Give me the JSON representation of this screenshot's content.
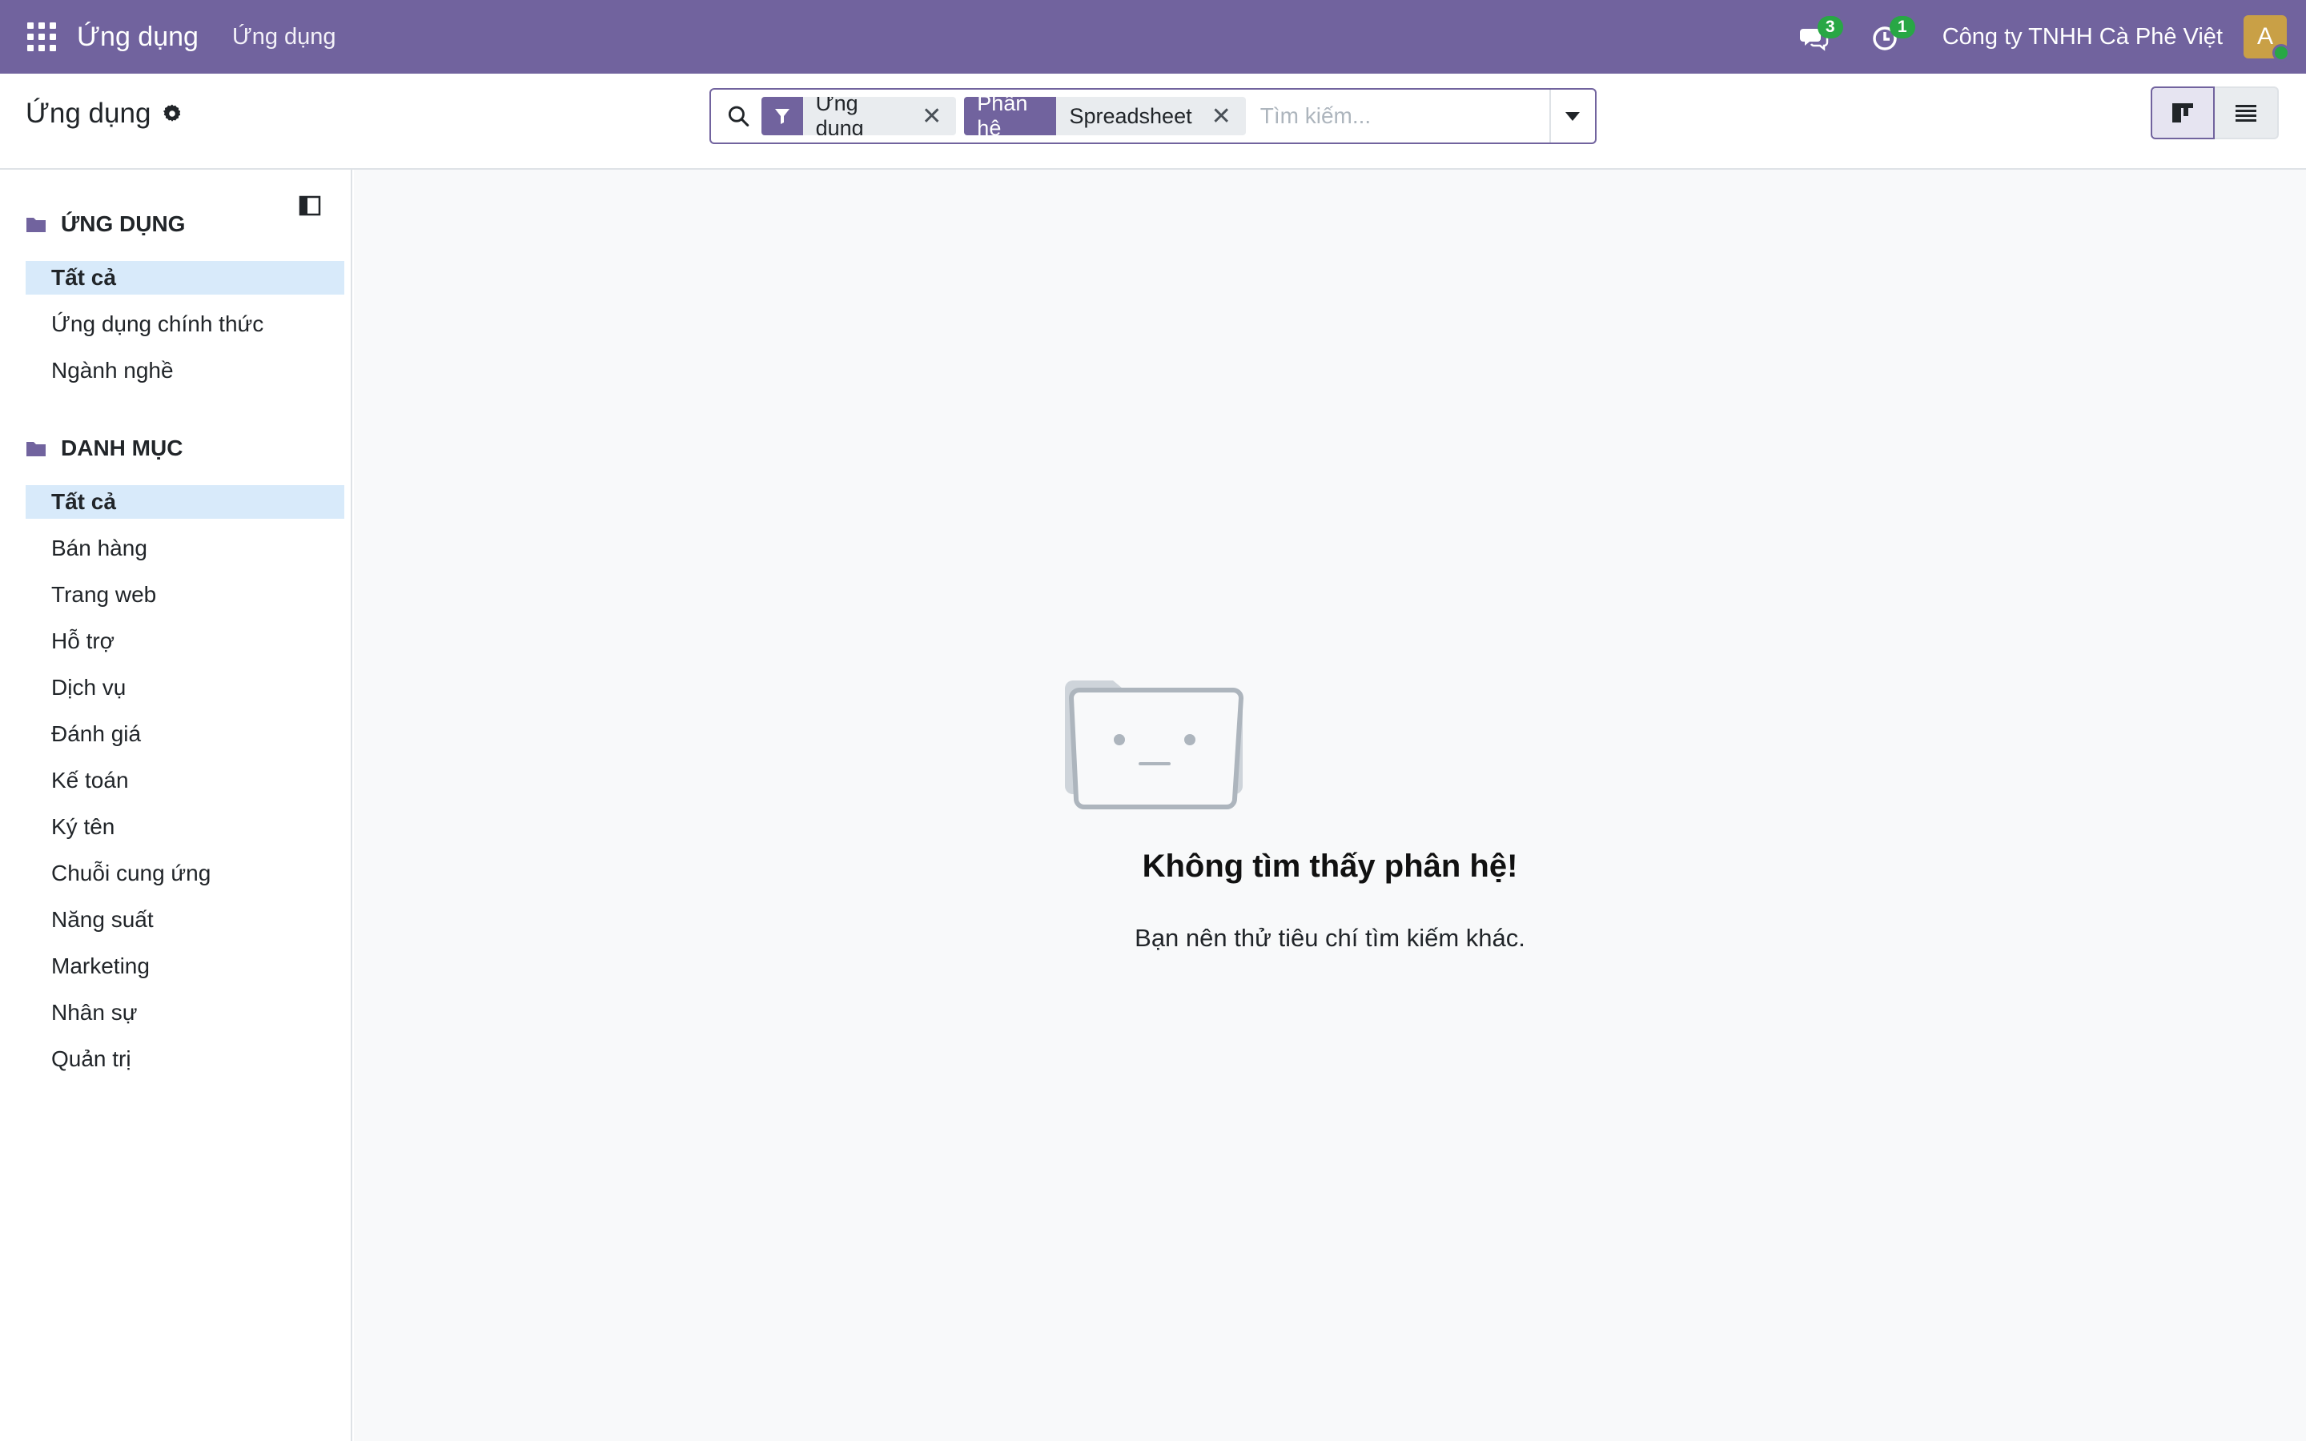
{
  "navbar": {
    "brand": "Ứng dụng",
    "menu_item": "Ứng dụng",
    "messages_count": "3",
    "activities_count": "1",
    "company": "Công ty TNHH Cà Phê Việt",
    "avatar_initial": "A",
    "color": "#71639e"
  },
  "control_panel": {
    "title": "Ứng dụng",
    "search": {
      "facets": [
        {
          "label_icon": "filter-icon",
          "value": "Ứng dụng"
        },
        {
          "label": "Phân hệ",
          "value": "Spreadsheet"
        }
      ],
      "placeholder": "Tìm kiếm..."
    },
    "views": [
      "kanban",
      "list"
    ],
    "active_view": "kanban"
  },
  "sidebar": {
    "sections": [
      {
        "title": "ỨNG DỤNG",
        "items": [
          "Tất cả",
          "Ứng dụng chính thức",
          "Ngành nghề"
        ],
        "active": "Tất cả"
      },
      {
        "title": "DANH MỤC",
        "items": [
          "Tất cả",
          "Bán hàng",
          "Trang web",
          "Hỗ trợ",
          "Dịch vụ",
          "Đánh giá",
          "Kế toán",
          "Ký tên",
          "Chuỗi cung ứng",
          "Năng suất",
          "Marketing",
          "Nhân sự",
          "Quản trị"
        ],
        "active": "Tất cả"
      }
    ]
  },
  "empty_state": {
    "title": "Không tìm thấy phân hệ!",
    "message": "Bạn nên thử tiêu chí tìm kiếm khác."
  }
}
